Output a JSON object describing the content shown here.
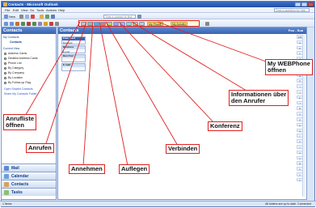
{
  "window": {
    "title": "Contacts - Microsoft Outlook"
  },
  "menubar": {
    "items": [
      "File",
      "Edit",
      "View",
      "Go",
      "Tools",
      "Actions",
      "Help"
    ],
    "help_placeholder": "Type a question for help"
  },
  "toolbar": {
    "new_label": "New",
    "search_placeholder": "Type a contact to find"
  },
  "webphone_toolbar": {
    "my_webphone_label": "My Phone",
    "my_anrufer_label": "My Anrufer"
  },
  "nav": {
    "header": "Contacts",
    "my_contacts_label": "My Contacts",
    "contacts_folder": "Contacts",
    "current_view_label": "Current View",
    "views": [
      "Address Cards",
      "Detailed Address Cards",
      "Phone List",
      "By Category",
      "By Company",
      "By Location",
      "By Follow-up Flag"
    ],
    "selected_view_index": 0,
    "links": [
      "Open Shared Contacts",
      "Share My Contacts Folder"
    ],
    "big_buttons": [
      "Mail",
      "Calendar",
      "Contacts",
      "Tasks"
    ]
  },
  "content": {
    "title": "Contacts",
    "range": "Fou - Sua",
    "cards": [
      {
        "name": "Fran, Gerd",
        "lines": [
          "Business:"
        ],
        "selected": true
      },
      {
        "name": "Business",
        "lines": [
          "E-mail:"
        ],
        "selected": false
      },
      {
        "name": "Busi Fax:",
        "lines": [
          ""
        ],
        "selected": false
      },
      {
        "name": "E-mail:",
        "lines": [
          ""
        ],
        "selected": false
      }
    ],
    "alphabet": [
      "123",
      "a",
      "b",
      "c",
      "d",
      "e",
      "f",
      "g",
      "h",
      "i",
      "j",
      "k",
      "l",
      "m",
      "n",
      "o",
      "p",
      "q",
      "r",
      "s",
      "t",
      "u",
      "v",
      "w",
      "x",
      "y",
      "z"
    ]
  },
  "statusbar": {
    "left": "1 Items",
    "right": "All folders are up to date.   Connected"
  },
  "callouts": {
    "anrufliste": "Anrufliste\nöffnen",
    "anrufen": "Anrufen",
    "annehmen": "Annehmen",
    "auflegen": "Auflegen",
    "verbinden": "Verbinden",
    "konferenz": "Konferenz",
    "informationen": "Informationen über\nden Anrufer",
    "webphone": "My WEBPhone\nöffnen"
  },
  "colors": {
    "callout_border": "#e02020",
    "header_blue": "#3a63b0",
    "window_bg": "#d9e5f5"
  }
}
